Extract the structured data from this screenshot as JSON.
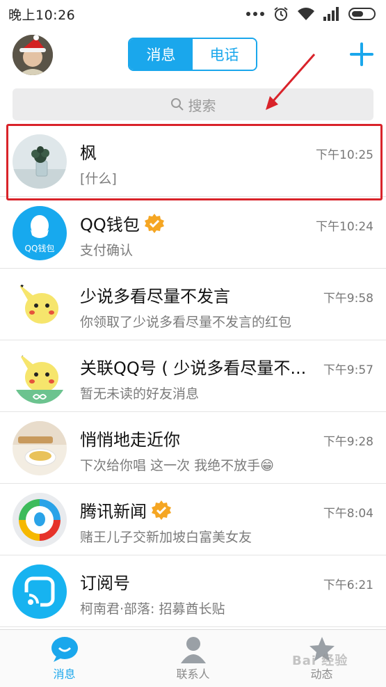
{
  "status_bar": {
    "time": "晚上10:26"
  },
  "header": {
    "tabs": [
      {
        "label": "消息",
        "active": true
      },
      {
        "label": "电话",
        "active": false
      }
    ],
    "accent_color": "#1aa7ec"
  },
  "search": {
    "placeholder": "搜索"
  },
  "conversations": [
    {
      "name": "枫",
      "message": "[什么]",
      "time": "下午10:25",
      "highlighted": true
    },
    {
      "name": "QQ钱包",
      "verified": true,
      "avatar_text": "QQ钱包",
      "message": "支付确认",
      "time": "下午10:24"
    },
    {
      "name": "少说多看尽量不发言",
      "message": "你领取了少说多看尽量不发言的红包",
      "time": "下午9:58"
    },
    {
      "name": "关联QQ号 ( 少说多看尽量不...",
      "message": "暂无未读的好友消息",
      "time": "下午9:57"
    },
    {
      "name": "悄悄地走近你",
      "message": "下次给你唱  这一次  我绝不放手😁",
      "time": "下午9:28"
    },
    {
      "name": "腾讯新闻",
      "verified": true,
      "message": "赌王儿子交新加坡白富美女友",
      "time": "下午8:04"
    },
    {
      "name": "订阅号",
      "message": "柯南君·部落: 招募酋长贴",
      "time": "下午6:21"
    }
  ],
  "bottom_tabs": [
    {
      "label": "消息",
      "icon": "chat-bubble-icon",
      "active": true
    },
    {
      "label": "联系人",
      "icon": "contacts-person-icon",
      "active": false
    },
    {
      "label": "动态",
      "icon": "star-icon",
      "active": false
    }
  ],
  "watermark": "Bai 经验"
}
